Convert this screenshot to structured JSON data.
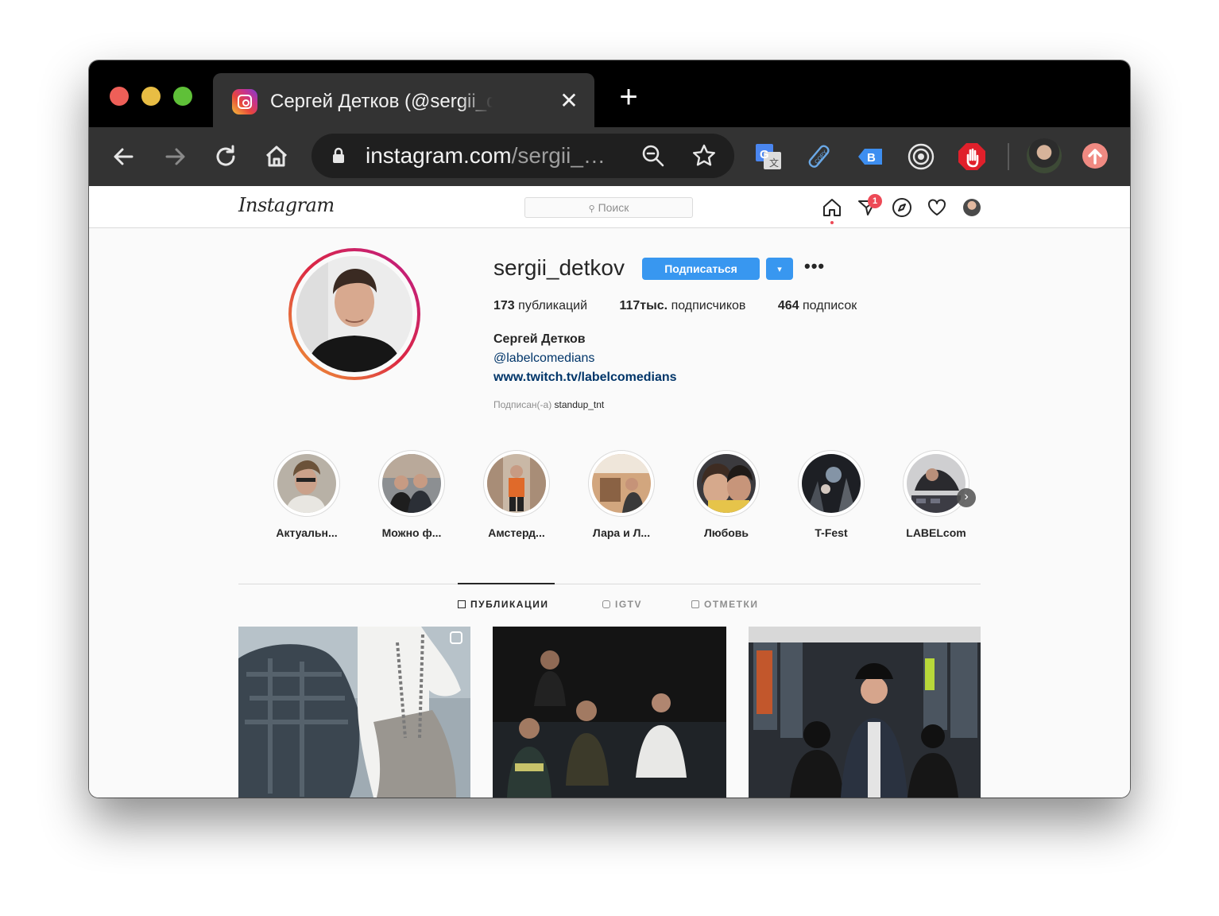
{
  "browser": {
    "tab_title": "Сергей Детков (@sergii_detkov) • Фото и видео в Instagram",
    "tab_close_glyph": "✕",
    "new_tab_glyph": "+",
    "url_host": "instagram.com",
    "url_path": "/sergii_…",
    "traffic_lights": {
      "close": "#ee5f58",
      "minimize": "#e8bd44",
      "zoom": "#5fc038"
    },
    "icons": [
      "back-icon",
      "forward-icon",
      "reload-icon",
      "home-icon",
      "lock-icon",
      "zoom-out-icon",
      "bookmark-star-icon",
      "google-translate-icon",
      "copy-pin-icon",
      "tag-extension-icon",
      "target-extension-icon",
      "adblock-hand-icon",
      "profile-avatar",
      "update-icon"
    ]
  },
  "instagram": {
    "logo": "Instagram",
    "search_placeholder": "Поиск",
    "notification_count": "1",
    "profile": {
      "username": "sergii_detkov",
      "follow_label": "Подписаться",
      "dropdown_glyph": "▾",
      "more_glyph": "•••",
      "stats": {
        "posts_count": "173",
        "posts_label": "публикаций",
        "followers_count": "117тыс.",
        "followers_label": "подписчиков",
        "following_count": "464",
        "following_label": "подписок"
      },
      "full_name": "Сергей Детков",
      "mention": "@labelcomedians",
      "website": "www.twitch.tv/labelcomedians",
      "followed_by_label": "Подписан(-а)",
      "followed_by_user": "standup_tnt"
    },
    "highlights": [
      {
        "label": "Актуальн..."
      },
      {
        "label": "Можно ф..."
      },
      {
        "label": "Амстерд..."
      },
      {
        "label": "Лара и Л..."
      },
      {
        "label": "Любовь"
      },
      {
        "label": "T-Fest"
      },
      {
        "label": "LABELcom"
      }
    ],
    "tabs": [
      {
        "label": "ПУБЛИКАЦИИ",
        "active": true
      },
      {
        "label": "IGTV",
        "active": false
      },
      {
        "label": "ОТМЕТКИ",
        "active": false
      }
    ],
    "accent_color": "#3897f0"
  }
}
